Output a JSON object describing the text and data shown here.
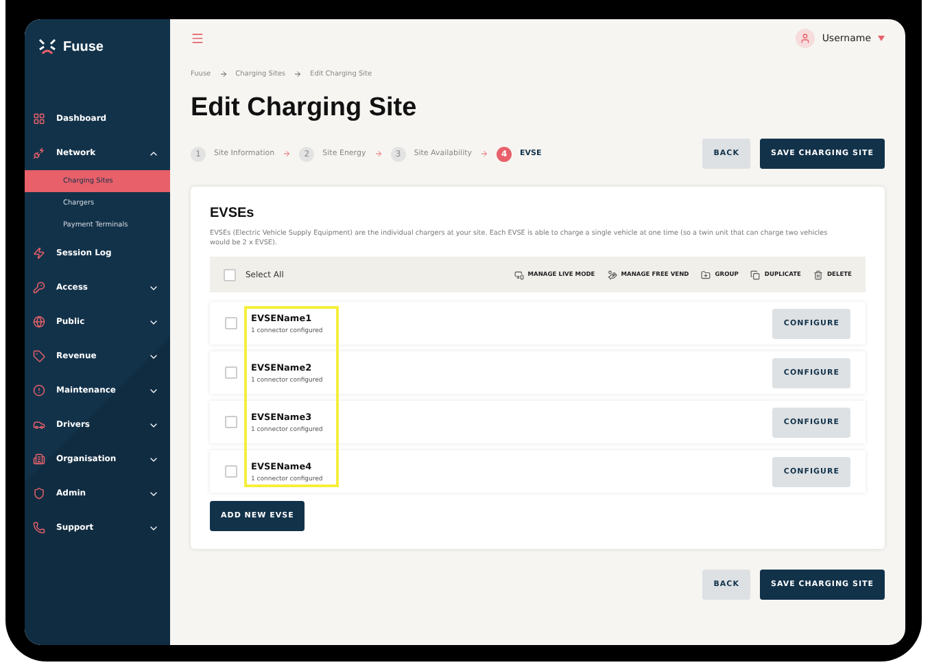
{
  "brand": "Fuuse",
  "sidebar": {
    "items": [
      {
        "label": "Dashboard",
        "selected": false
      },
      {
        "label": "Network",
        "expanded": true,
        "selected": false,
        "children": [
          {
            "label": "Charging Sites",
            "selected": true
          },
          {
            "label": "Chargers",
            "selected": false
          },
          {
            "label": "Payment Terminals",
            "selected": false
          }
        ]
      },
      {
        "label": "Session Log",
        "selected": false
      },
      {
        "label": "Access",
        "expanded": false,
        "selected": false
      },
      {
        "label": "Public",
        "expanded": false,
        "selected": false
      },
      {
        "label": "Revenue",
        "expanded": false,
        "selected": false
      },
      {
        "label": "Maintenance",
        "expanded": false,
        "selected": false
      },
      {
        "label": "Drivers",
        "expanded": false,
        "selected": false
      },
      {
        "label": "Organisation",
        "expanded": false,
        "selected": false
      },
      {
        "label": "Admin",
        "expanded": false,
        "selected": false
      },
      {
        "label": "Support",
        "expanded": false,
        "selected": false
      }
    ]
  },
  "user": {
    "name": "Username"
  },
  "breadcrumb": [
    "Fuuse",
    "Charging Sites",
    "Edit Charging Site"
  ],
  "title": "Edit Charging Site",
  "steps": [
    {
      "number": "1",
      "label": "Site Information",
      "selected": false
    },
    {
      "number": "2",
      "label": "Site Energy",
      "selected": false
    },
    {
      "number": "3",
      "label": "Site Availability",
      "selected": false
    },
    {
      "number": "4",
      "label": "EVSE",
      "selected": true
    }
  ],
  "actions": {
    "back": "BACK",
    "save": "SAVE CHARGING SITE"
  },
  "card": {
    "title": "EVSEs",
    "description": "EVSEs (Electric Vehicle Supply Equipment) are the individual chargers at your site. Each EVSE is able to charge a single vehicle at one time (so a twin unit that can charge two vehicles would be 2 x EVSE).",
    "select_all": {
      "label": "Select All",
      "checked": false
    },
    "tools": [
      {
        "kind": "live",
        "label": "MANAGE LIVE MODE"
      },
      {
        "kind": "vend",
        "label": "MANAGE FREE VEND"
      },
      {
        "kind": "group",
        "label": "GROUP"
      },
      {
        "kind": "duplicate",
        "label": "DUPLICATE"
      },
      {
        "kind": "delete",
        "label": "DELETE"
      }
    ],
    "evses": [
      {
        "name": "EVSEName1",
        "status": "1 connector configured",
        "checked": false,
        "button": "CONFIGURE"
      },
      {
        "name": "EVSEName2",
        "status": "1 connector configured",
        "checked": false,
        "button": "CONFIGURE"
      },
      {
        "name": "EVSEName3",
        "status": "1 connector configured",
        "checked": false,
        "button": "CONFIGURE"
      },
      {
        "name": "EVSEName4",
        "status": "1 connector configured",
        "checked": false,
        "button": "CONFIGURE"
      }
    ],
    "add_button": "ADD NEW EVSE"
  },
  "footer_actions": {
    "back": "BACK",
    "save": "SAVE CHARGING SITE"
  }
}
